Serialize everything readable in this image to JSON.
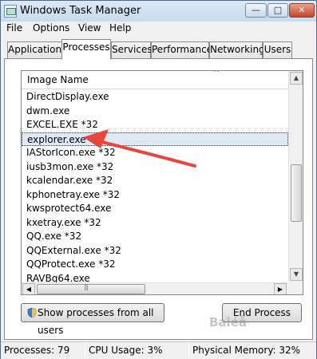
{
  "window": {
    "title": "Windows Task Manager",
    "minimize_glyph": "—",
    "maximize_glyph": "□",
    "close_glyph": "✕"
  },
  "menu": [
    "File",
    "Options",
    "View",
    "Help"
  ],
  "tabs": [
    "Applications",
    "Processes",
    "Services",
    "Performance",
    "Networking",
    "Users"
  ],
  "active_tab": "Processes",
  "list": {
    "header": "Image Name",
    "sort_indicator": "^",
    "rows": [
      "DirectDisplay.exe",
      "dwm.exe",
      "EXCEL.EXE *32",
      "explorer.exe",
      "IAStorIcon.exe *32",
      "iusb3mon.exe *32",
      "kcalendar.exe *32",
      "kphonetray.exe *32",
      "kwsprotect64.exe",
      "kxetray.exe *32",
      "QQ.exe *32",
      "QQExternal.exe *32",
      "QQProtect.exe *32",
      "RAVBg64.exe"
    ],
    "selected_row": "explorer.exe"
  },
  "scrollbar_glyphs": {
    "up": "▲",
    "down": "▼",
    "left": "◀",
    "right": "▶"
  },
  "buttons": {
    "show_processes": "Show processes from all users",
    "end_process": "End Process"
  },
  "status": {
    "processes": "Processes: 79",
    "cpu": "CPU Usage: 3%",
    "memory": "Physical Memory: 32%"
  },
  "watermark": "Baiéå",
  "colors": {
    "annotation_arrow": "#e8463c",
    "title_gradient_top": "#dde9f5",
    "selection": "#dfe9f5"
  }
}
